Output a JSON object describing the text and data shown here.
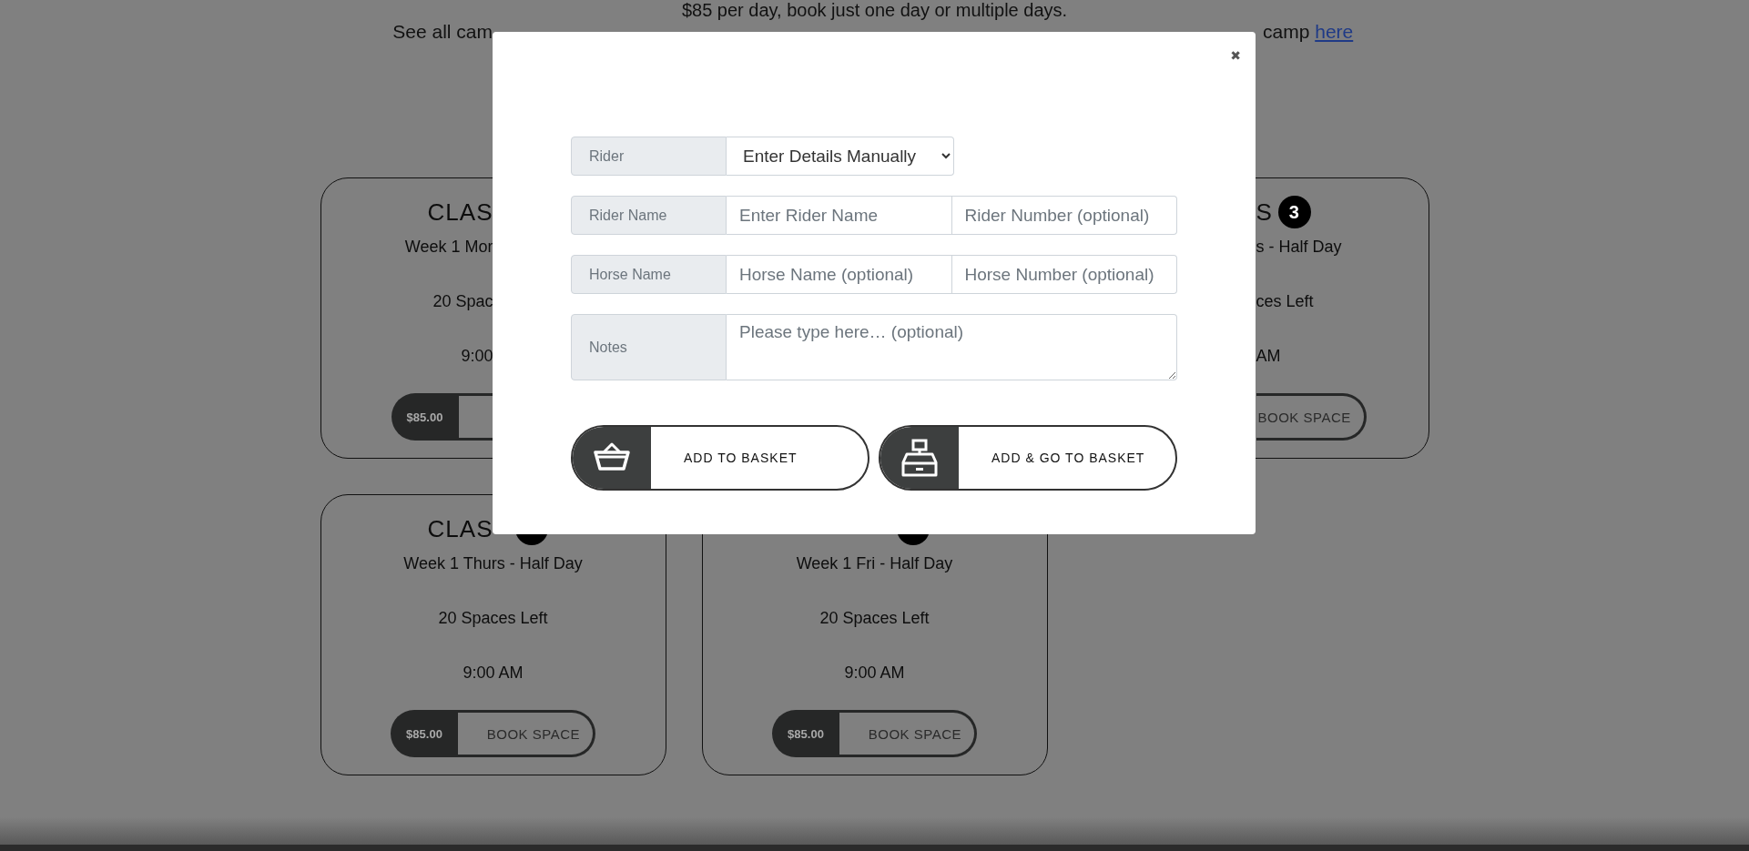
{
  "intro": {
    "pricing": "$85 per day, book just one day or multiple days.",
    "info_left": "See all cam",
    "info_right": "camp",
    "link": "here"
  },
  "cards": [
    {
      "kind": "cut-right",
      "title": "CLAS",
      "date": "Week 1 Mor",
      "spaces": "20 Spac",
      "time": "9:00",
      "price": "$85.00"
    },
    {
      "kind": "cut-left",
      "title": "S",
      "badge": "3",
      "date": "s - Half Day",
      "spaces": "ces Left",
      "time": "AM",
      "book": "BOOK SPACE"
    },
    {
      "kind": "lower",
      "title": "CLAS",
      "badge_visible": true,
      "date": "Week 1 Thurs - Half Day",
      "spaces": "20 Spaces Left",
      "time": "9:00 AM",
      "price": "$85.00",
      "book": "BOOK SPACE"
    },
    {
      "kind": "lower",
      "badge_visible": true,
      "date": "Week 1 Fri - Half Day",
      "spaces": "20 Spaces Left",
      "time": "9:00 AM",
      "price": "$85.00",
      "book": "BOOK SPACE"
    }
  ],
  "modal": {
    "close": "✖",
    "rows": [
      {
        "kind": "select",
        "label": "Rider",
        "value": "Enter Details Manually"
      },
      {
        "kind": "pair",
        "label": "Rider Name",
        "placeholders": [
          "Enter Rider Name",
          "Rider Number (optional)"
        ]
      },
      {
        "kind": "pair",
        "label": "Horse Name",
        "placeholders": [
          "Horse Name (optional)",
          "Horse Number (optional)"
        ]
      },
      {
        "kind": "textarea",
        "label": "Notes",
        "placeholder": "Please type here… (optional)"
      }
    ],
    "buttons": [
      {
        "kind": "basket",
        "label": "ADD TO BASKET"
      },
      {
        "kind": "register",
        "label": "ADD & GO TO BASKET"
      }
    ]
  }
}
